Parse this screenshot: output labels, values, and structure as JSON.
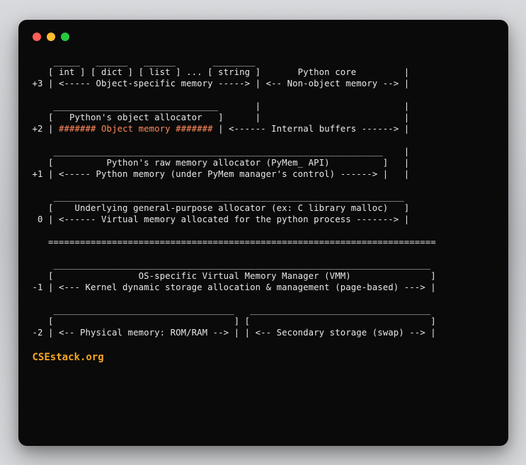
{
  "traffic": {
    "red": "#ff5f56",
    "yellow": "#ffbd2e",
    "green": "#27c93f"
  },
  "lines": [
    "    _____   ______   ______       ________",
    "   [ int ] [ dict ] [ list ] ... [ string ]       Python core         |",
    "+3 | <----- Object-specific memory -----> | <-- Non-object memory --> |",
    "",
    "    _______________________________       |                           |",
    "   [   Python's object allocator   ]      |                           |"
  ],
  "accent_left": "+2 | ",
  "accent_mid": "####### Object memory #######",
  "accent_right": " | <------ Internal buffers ------> |",
  "lines2": [
    "",
    "    ______________________________________________________________    |",
    "   [          Python's raw memory allocator (PyMem_ API)          ]   |",
    "+1 | <----- Python memory (under PyMem manager's control) ------> |   |",
    "",
    "    __________________________________________________________________",
    "   [    Underlying general-purpose allocator (ex: C library malloc)   ]",
    " 0 | <------ Virtual memory allocated for the python process -------> |",
    "",
    "   =========================================================================",
    "",
    "    _______________________________________________________________________",
    "   [                OS-specific Virtual Memory Manager (VMM)               ]",
    "-1 | <--- Kernel dynamic storage allocation & management (page-based) ---> |",
    "",
    "    __________________________________   __________________________________",
    "   [                                  ] [                                  ]",
    "-2 | <-- Physical memory: ROM/RAM --> | | <-- Secondary storage (swap) --> |"
  ],
  "brand": "CSEstack.org"
}
